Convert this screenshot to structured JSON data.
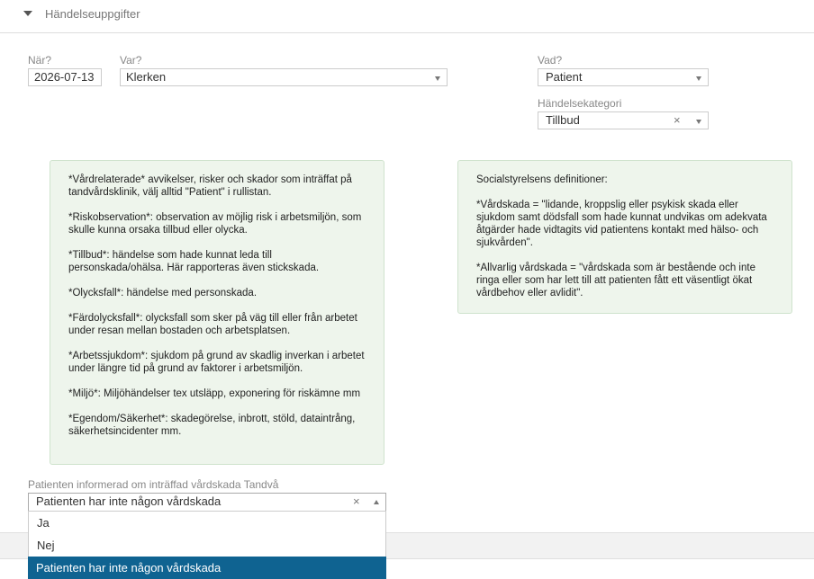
{
  "section": {
    "title": "Händelseuppgifter"
  },
  "when": {
    "label": "När?",
    "value": "2026-07-13"
  },
  "where": {
    "label": "Var?",
    "value": "Klerken"
  },
  "what": {
    "label": "Vad?",
    "value": "Patient"
  },
  "category": {
    "label": "Händelsekategori",
    "value": "Tillbud",
    "clear": "×"
  },
  "info_left": [
    "*Vårdrelaterade* avvikelser, risker och skador som inträffat på tandvårdsklinik, välj alltid \"Patient\" i rullistan.",
    "*Riskobservation*: observation av möjlig risk i arbetsmiljön, som skulle kunna orsaka tillbud eller olycka.",
    "*Tillbud*: händelse som hade kunnat leda till personskada/ohälsa. Här rapporteras även stickskada.",
    "*Olycksfall*: händelse med personskada.",
    "*Färdolycksfall*: olycksfall som sker på väg till eller från arbetet under resan mellan bostaden och arbetsplatsen.",
    "*Arbetssjukdom*: sjukdom på grund av skadlig inverkan i arbetet under längre tid på grund av faktorer i arbetsmiljön.",
    "*Miljö*: Miljöhändelser tex utsläpp, exponering för riskämne mm",
    "*Egendom/Säkerhet*: skadegörelse, inbrott, stöld, dataintrång, säkerhetsincidenter mm."
  ],
  "info_right": [
    "Socialstyrelsens definitioner:",
    "*Vårdskada = \"lidande, kroppslig eller psykisk skada eller sjukdom samt dödsfall som hade kunnat undvikas om adekvata åtgärder hade vidtagits vid patientens kontakt med hälso- och sjukvården\".",
    "*Allvarlig vårdskada = \"vårdskada som är bestående och inte ringa eller som har lett till att patienten fått ett väsentligt ökat vårdbehov eller avlidit\"."
  ],
  "informed": {
    "label": "Patienten informerad om inträffad vårdskada Tandvå",
    "value": "Patienten har inte någon vårdskada",
    "clear": "×",
    "options": [
      "Ja",
      "Nej",
      "Patienten har inte någon vårdskada"
    ]
  }
}
